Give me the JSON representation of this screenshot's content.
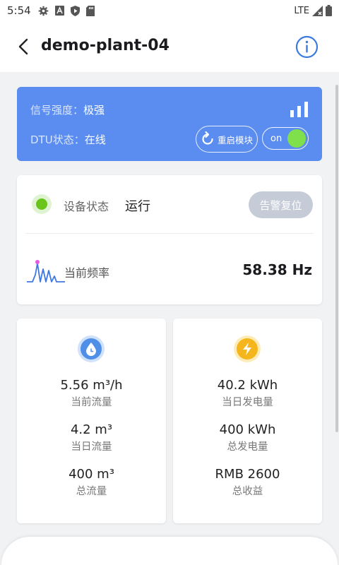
{
  "status_bar": {
    "time": "5:54",
    "network": "LTE"
  },
  "header": {
    "title": "demo-plant-04"
  },
  "signal_card": {
    "signal_label": "信号强度：",
    "signal_value": "极强",
    "dtu_label": "DTU状态：",
    "dtu_value": "在线",
    "restart_label": "重启模块",
    "toggle_label": "on",
    "toggle_on": true
  },
  "status_card": {
    "device_label": "设备状态",
    "device_value": "运行",
    "alarm_reset_label": "告警复位",
    "freq_label": "当前频率",
    "freq_value": "58.38 Hz"
  },
  "flow_card": {
    "icon": "water-drop-clock-icon",
    "stats": [
      {
        "value": "5.56 m³/h",
        "label": "当前流量"
      },
      {
        "value": "4.2 m³",
        "label": "当日流量"
      },
      {
        "value": "400 m³",
        "label": "总流量"
      }
    ]
  },
  "power_card": {
    "icon": "lightning-icon",
    "stats": [
      {
        "value": "40.2 kWh",
        "label": "当日发电量"
      },
      {
        "value": "400 kWh",
        "label": "总发电量"
      },
      {
        "value": "RMB 2600",
        "label": "总收益"
      }
    ]
  },
  "colors": {
    "accent": "#5b8df0",
    "status_green": "#69c51c",
    "toggle_knob": "#7fe04b",
    "flow_icon": "#4f8fe8",
    "power_icon": "#f5b51c",
    "info_icon": "#3b7be0"
  }
}
